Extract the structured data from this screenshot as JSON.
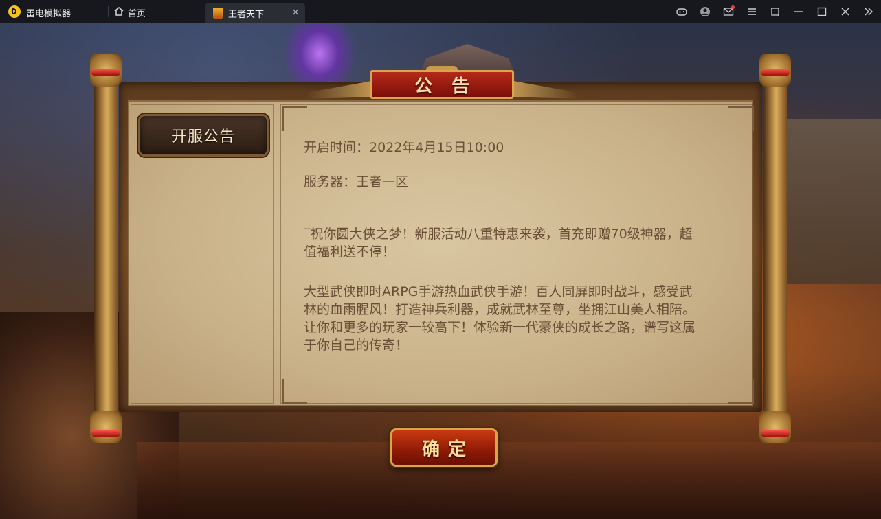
{
  "titlebar": {
    "app_name": "雷电模拟器",
    "home_tab_label": "首页",
    "game_tab_label": "王者天下",
    "tab_close": "×"
  },
  "dialog": {
    "title": "公告",
    "tab_label": "开服公告",
    "open_time": "开启时间：2022年4月15日10:00",
    "server": "服务器：王者一区",
    "intro": "‾祝你圆大侠之梦！新服活动八重特惠来袭，首充即赠70级神器，超值福利送不停！",
    "description": "大型武侠即时ARPG手游热血武侠手游！百人同屏即时战斗，感受武林的血雨腥风！打造神兵利器，成就武林至尊，坐拥江山美人相陪。让你和更多的玩家一较高下！体验新一代豪侠的成长之路，谱写这属于你自己的传奇！",
    "confirm_label": "确定"
  },
  "colors": {
    "titlebar_bg": "#16181d",
    "accent_red": "#b52a1a",
    "gold_border": "#d7a64f",
    "parchment": "#d9c7a2",
    "body_text": "#6a4e36"
  },
  "icons": [
    "gamepad-icon",
    "user-icon",
    "mail-icon",
    "menu-icon",
    "screen-crop-icon",
    "minimize-icon",
    "maximize-icon",
    "close-icon",
    "collapse-icon"
  ]
}
